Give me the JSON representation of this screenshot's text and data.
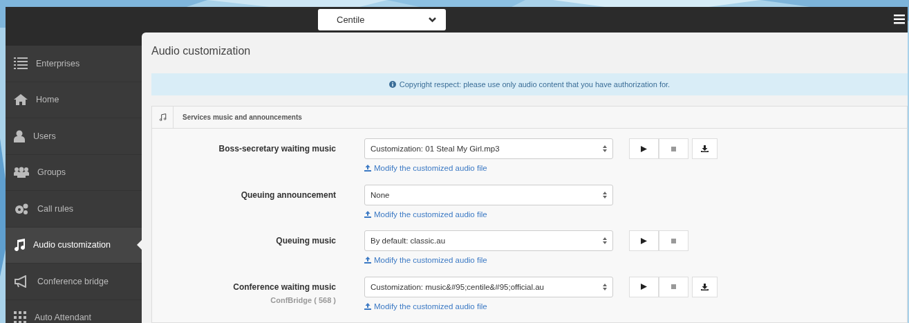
{
  "topbar": {
    "org_select": {
      "value": "Centile"
    }
  },
  "sidebar": {
    "items": [
      {
        "label": "Enterprises",
        "selected": false
      },
      {
        "label": "Home",
        "selected": false
      },
      {
        "label": "Users",
        "selected": false
      },
      {
        "label": "Groups",
        "selected": false
      },
      {
        "label": "Call rules",
        "selected": false
      },
      {
        "label": "Audio customization",
        "selected": true
      },
      {
        "label": "Conference bridge",
        "selected": false
      },
      {
        "label": "Auto Attendant",
        "selected": false
      }
    ]
  },
  "page": {
    "title": "Audio customization",
    "alert": "Copyright respect: please use only audio content that you have authorization for.",
    "panel": {
      "title": "Services music and announcements",
      "rows": [
        {
          "label": "Boss-secretary waiting music",
          "value": "Customization: 01 Steal My Girl.mp3",
          "link": "Modify the customized audio file",
          "buttons": [
            {
              "kind": "play"
            },
            {
              "kind": "stop"
            },
            {
              "kind": "download"
            }
          ]
        },
        {
          "label": "Queuing announcement",
          "value": "None",
          "link": "Modify the customized audio file",
          "buttons": []
        },
        {
          "label": "Queuing music",
          "value": "By default: classic.au",
          "link": "Modify the customized audio file",
          "buttons": [
            {
              "kind": "play"
            },
            {
              "kind": "stop"
            }
          ]
        },
        {
          "label": "Conference waiting music",
          "sublabel": "ConfBridge ( 568 )",
          "value": "Customization: music&#95;centile&#95;official.au",
          "link": "Modify the customized audio file",
          "buttons": [
            {
              "kind": "play"
            },
            {
              "kind": "stop"
            },
            {
              "kind": "download"
            }
          ]
        }
      ]
    }
  }
}
